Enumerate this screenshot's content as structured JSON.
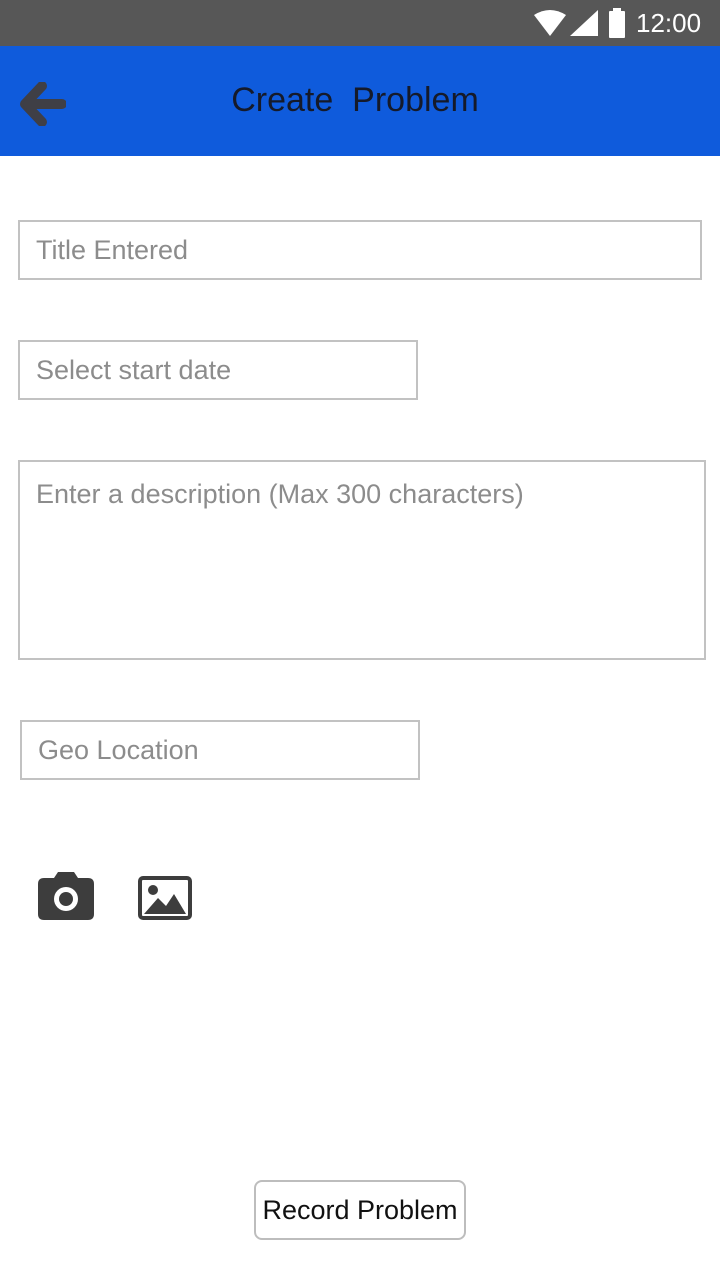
{
  "status_bar": {
    "time": "12:00",
    "icons": [
      "wifi-icon",
      "cell-signal-icon",
      "battery-icon"
    ]
  },
  "app_bar": {
    "title": "Create  Problem",
    "back_icon": "arrow-left-icon",
    "background_color": "#0f5bdc"
  },
  "form": {
    "title_placeholder": "Title Entered",
    "date_placeholder": "Select start date",
    "description_placeholder": "Enter a description (Max 300 characters)",
    "geo_placeholder": "Geo Location",
    "camera_icon": "camera-icon",
    "gallery_icon": "image-gallery-icon",
    "submit_label": "Record Problem"
  }
}
